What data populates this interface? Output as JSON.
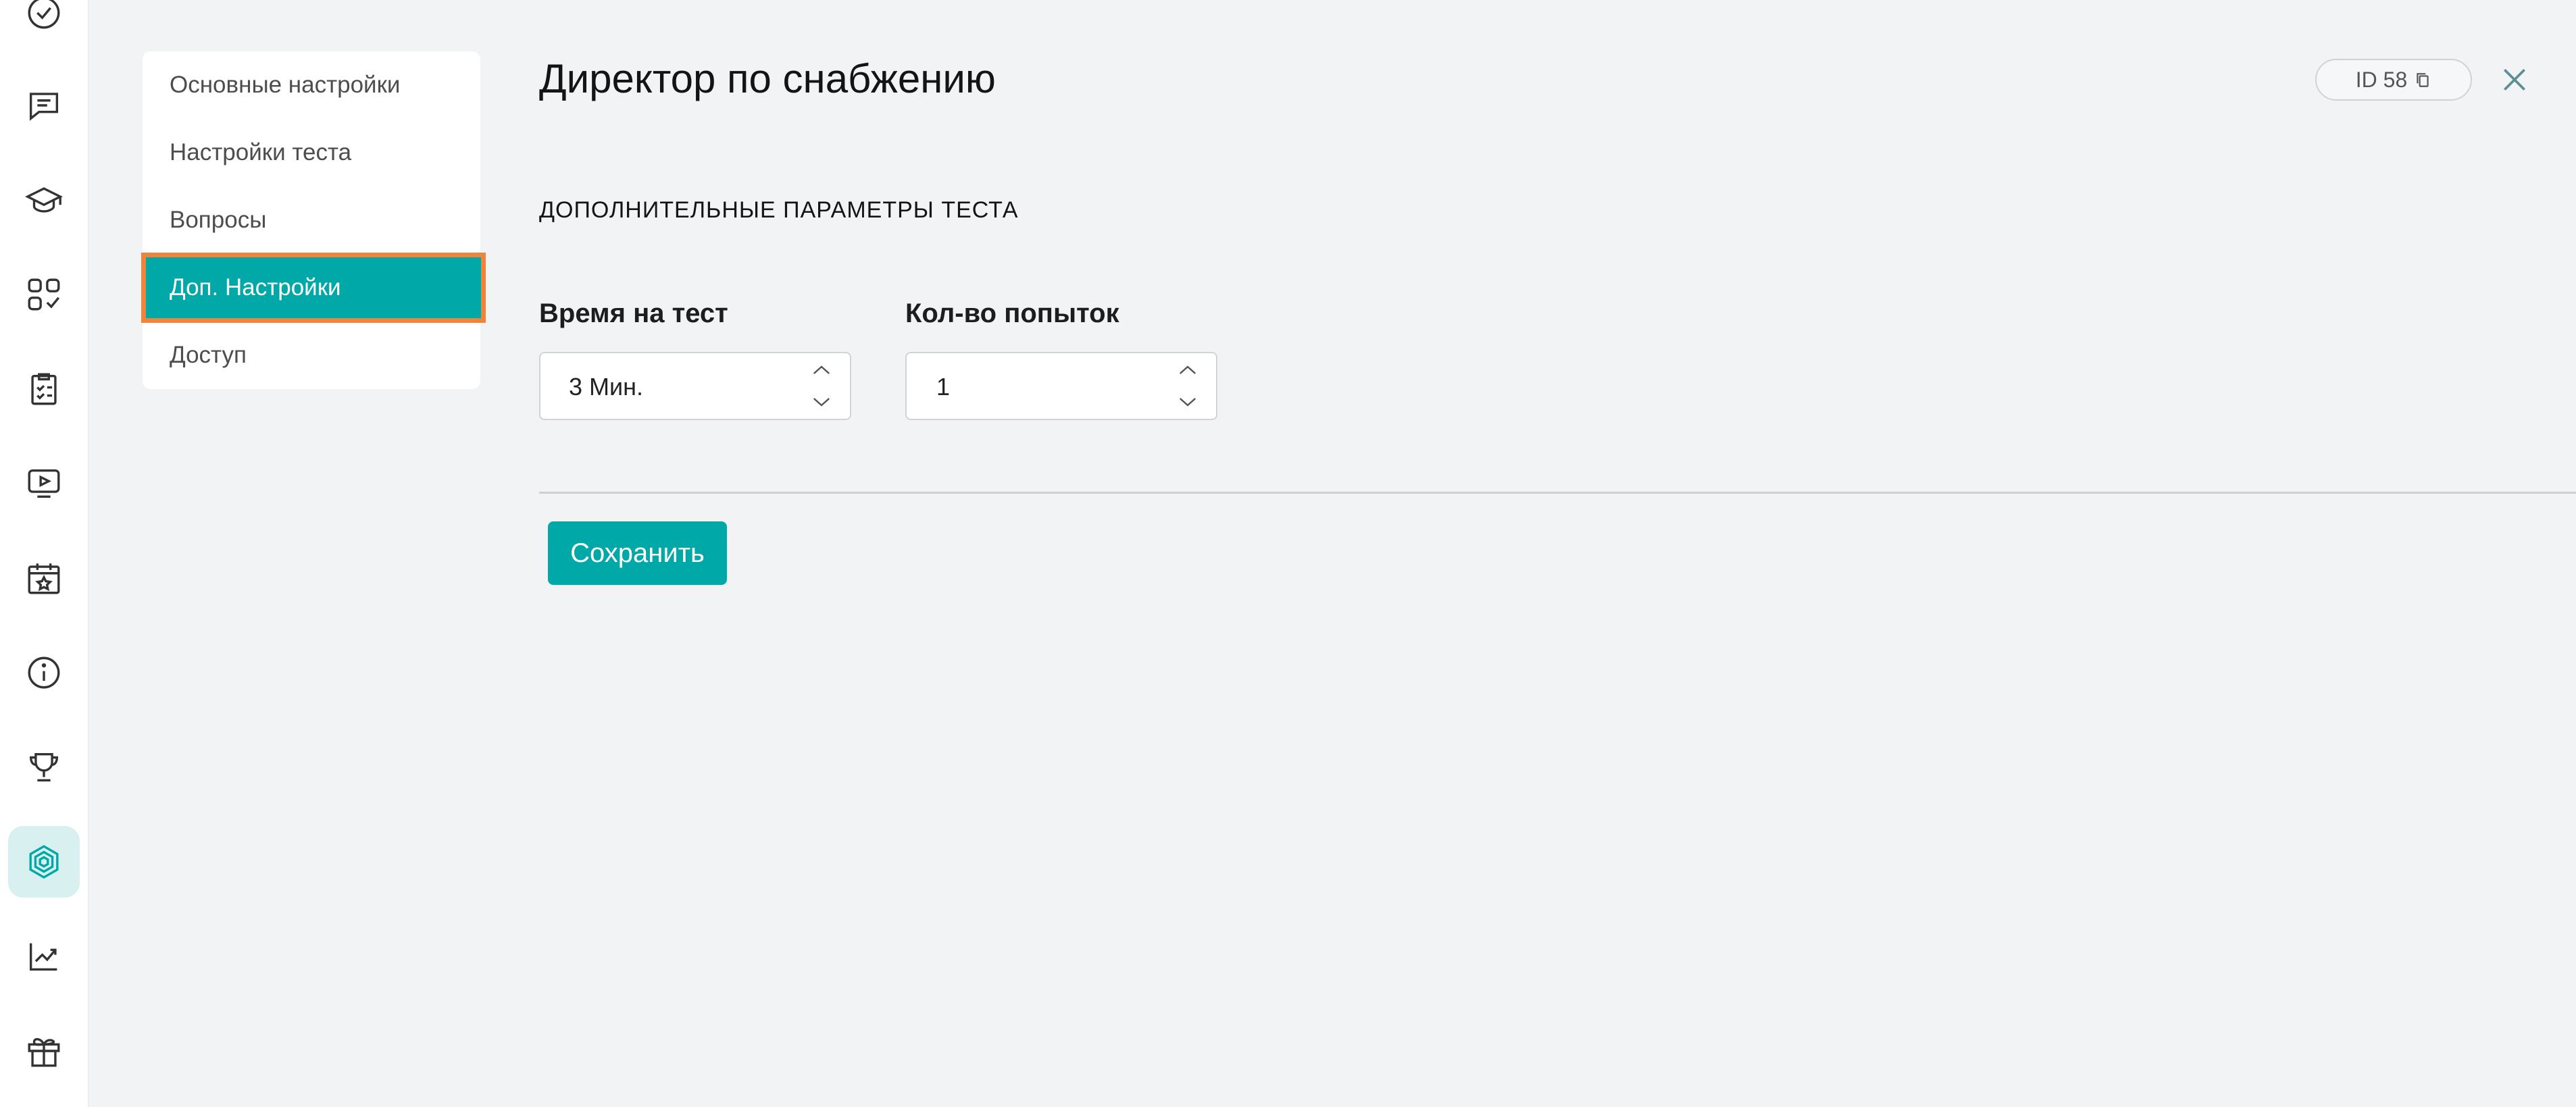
{
  "rail": {
    "icons": [
      {
        "name": "check-circle-icon"
      },
      {
        "name": "chat-icon"
      },
      {
        "name": "graduation-cap-icon"
      },
      {
        "name": "apps-icon"
      },
      {
        "name": "clipboard-checklist-icon"
      },
      {
        "name": "video-player-icon"
      },
      {
        "name": "calendar-star-icon"
      },
      {
        "name": "info-icon"
      },
      {
        "name": "trophy-icon"
      },
      {
        "name": "hexagon-icon"
      },
      {
        "name": "chart-icon"
      },
      {
        "name": "gift-icon"
      }
    ],
    "accent": "#00a8a8"
  },
  "menu": {
    "items": [
      {
        "label": "Основные настройки"
      },
      {
        "label": "Настройки теста"
      },
      {
        "label": "Вопросы"
      },
      {
        "label": "Доп. Настройки"
      },
      {
        "label": "Доступ"
      }
    ],
    "active_index": 3
  },
  "header": {
    "title": "Директор по снабжению",
    "id_label": "ID 58"
  },
  "section": {
    "title": "ДОПОЛНИТЕЛЬНЫЕ ПАРАМЕТРЫ ТЕСТА"
  },
  "fields": {
    "time": {
      "label": "Время на тест",
      "value": "3 Мин."
    },
    "attempts": {
      "label": "Кол-во попыток",
      "value": "1"
    }
  },
  "actions": {
    "save_label": "Сохранить"
  },
  "colors": {
    "accent": "#00a8a8",
    "highlight": "#f0843a",
    "background": "#f2f3f5"
  }
}
